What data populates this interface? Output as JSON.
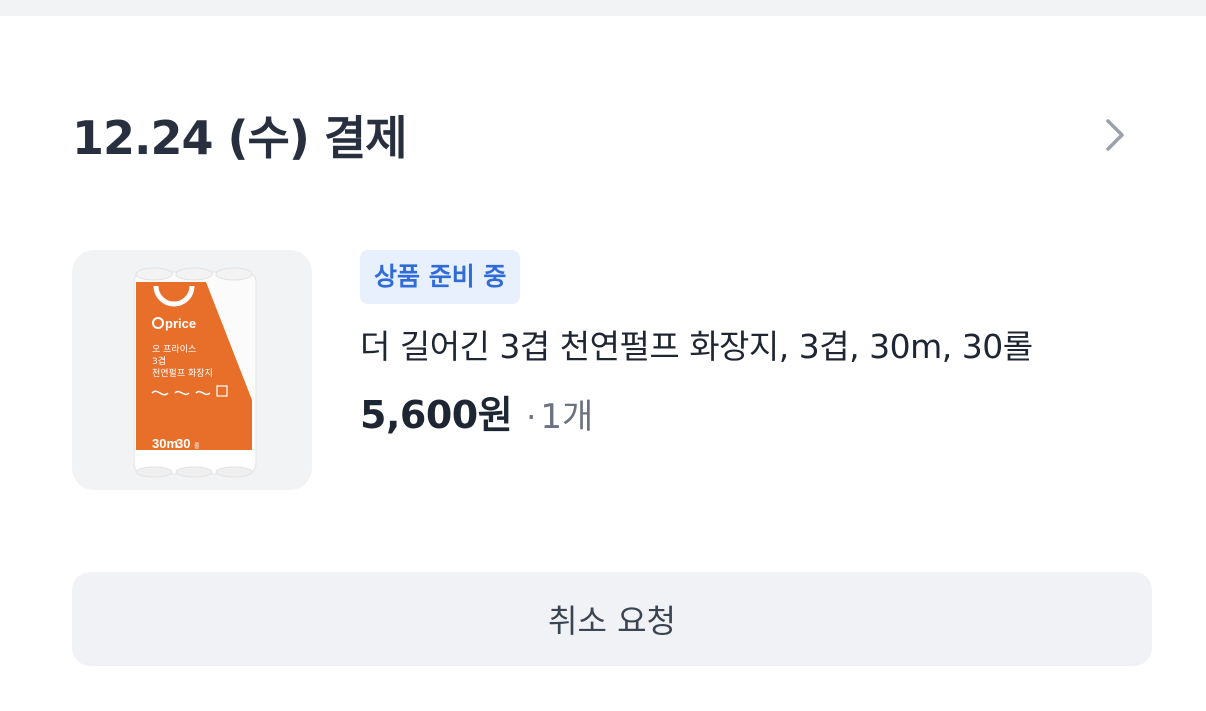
{
  "order": {
    "date_title": "12.24 (수) 결제"
  },
  "item": {
    "status_badge": "상품 준비 중",
    "name": "더 길어긴 3겹 천연펄프 화장지, 3겹, 30m, 30롤",
    "price": "5,600원",
    "qty_separator": "·",
    "quantity": "1개",
    "image": {
      "brand": "price",
      "label_1": "오 프라이스",
      "label_2": "3겹",
      "label_3": "천연펄프 화장지",
      "pack_length": "30m",
      "pack_count": "30",
      "pack_unit": "롤",
      "brand_color": "#e76f2a"
    }
  },
  "actions": {
    "cancel_label": "취소 요청"
  },
  "icons": {
    "header_arrow": "chevron-right-icon"
  },
  "colors": {
    "badge_bg": "#e8f0fd",
    "badge_text": "#2f6cd8",
    "button_bg": "#f0f2f5"
  }
}
